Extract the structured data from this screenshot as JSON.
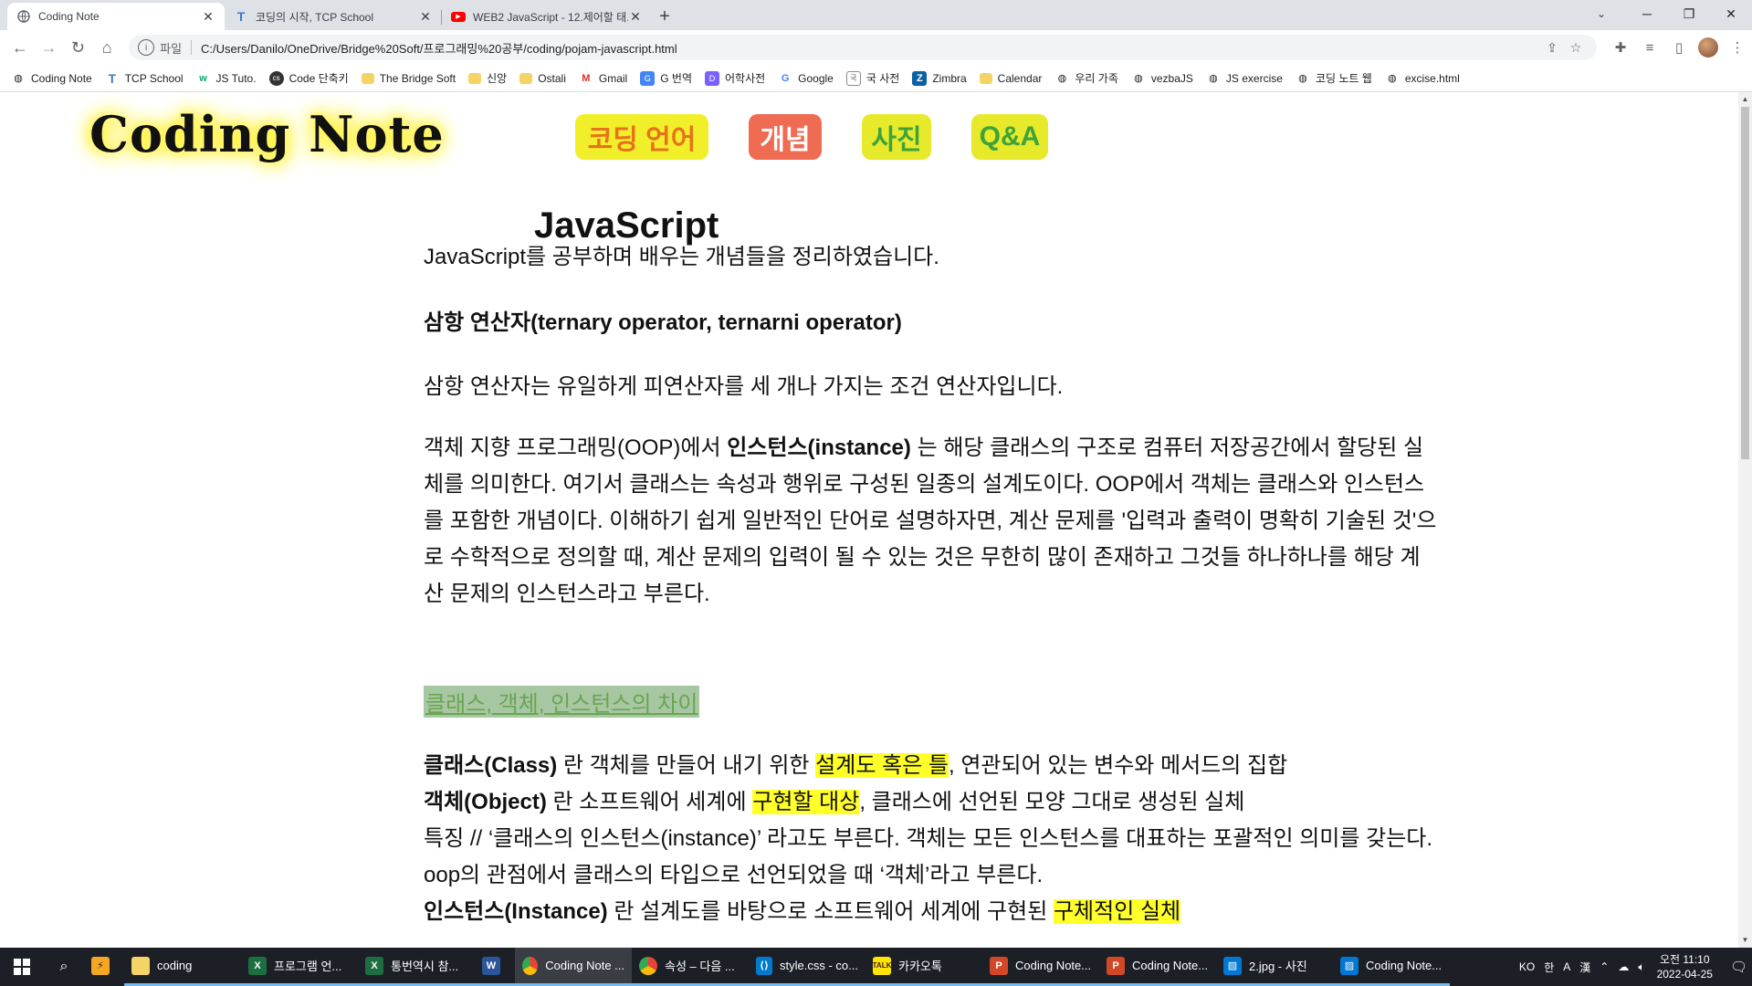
{
  "browser": {
    "tabs": [
      {
        "label": "Coding Note",
        "icon": "globe-icon",
        "active": true
      },
      {
        "label": "코딩의 시작, TCP School",
        "icon": "tcp-school-icon",
        "active": false
      },
      {
        "label": "WEB2 JavaScript - 12.제어할 태...",
        "icon": "youtube-icon",
        "active": false
      }
    ],
    "omnibox": {
      "scheme": "파일",
      "url": "C:/Users/Danilo/OneDrive/Bridge%20Soft/프로그래밍%20공부/coding/pojam-javascript.html"
    },
    "bookmarks": [
      {
        "label": "Coding Note",
        "icon": "globe-icon"
      },
      {
        "label": "TCP School",
        "icon": "tcp-school-icon"
      },
      {
        "label": "JS Tuto.",
        "icon": "w3-icon"
      },
      {
        "label": "Code 단축키",
        "icon": "code-icon"
      },
      {
        "label": "The Bridge Soft",
        "icon": "folder-icon"
      },
      {
        "label": "신앙",
        "icon": "folder-icon"
      },
      {
        "label": "Ostali",
        "icon": "folder-icon"
      },
      {
        "label": "Gmail",
        "icon": "gmail-icon"
      },
      {
        "label": "G 번역",
        "icon": "translate-icon"
      },
      {
        "label": "어학사전",
        "icon": "dictionary-icon"
      },
      {
        "label": "Google",
        "icon": "google-icon"
      },
      {
        "label": "국 사전",
        "icon": "dictionary-icon"
      },
      {
        "label": "Zimbra",
        "icon": "zimbra-icon"
      },
      {
        "label": "Calendar",
        "icon": "folder-icon"
      },
      {
        "label": "우리 가족",
        "icon": "globe-icon"
      },
      {
        "label": "vezbaJS",
        "icon": "globe-icon"
      },
      {
        "label": "JS exercise",
        "icon": "globe-icon"
      },
      {
        "label": "코딩 노트 웹",
        "icon": "globe-icon"
      },
      {
        "label": "excise.html",
        "icon": "globe-icon"
      }
    ]
  },
  "site": {
    "logo": "Coding Note",
    "nav": [
      "코딩 언어",
      "개념",
      "사진",
      "Q&A"
    ]
  },
  "article": {
    "title": "JavaScript",
    "intro": "JavaScript를 공부하며 배우는 개념들을 정리하였습니다.",
    "ternary_heading": "삼항 연산자(ternary operator, ternarni operator)",
    "ternary_text": "삼항 연산자는 유일하게 피연산자를 세 개나 가지는 조건 연산자입니다.",
    "instance_pre": "객체 지향 프로그래밍(OOP)에서 ",
    "instance_bold": "인스턴스(instance)",
    "instance_post": " 는 해당 클래스의 구조로 컴퓨터 저장공간에서 할당된 실체를 의미한다. 여기서 클래스는 속성과 행위로 구성된 일종의 설계도이다. OOP에서 객체는 클래스와 인스턴스를 포함한 개념이다. 이해하기 쉽게 일반적인 단어로 설명하자면, 계산 문제를 '입력과 출력이 명확히 기술된 것'으로 수학적으로 정의할 때, 계산 문제의 입력이 될 수 있는 것은 무한히 많이 존재하고 그것들 하나하나를 해당 계산 문제의 인스턴스라고 부른다.",
    "diff_link": "클래스, 객체, 인스턴스의 차이",
    "class_bold": "클래스(Class)",
    "class_pre": " 란 객체를 만들어 내기 위한 ",
    "class_hl": "설계도 혹은 틀",
    "class_post": ", 연관되어 있는 변수와 메서드의 집합",
    "object_bold": "객체(Object)",
    "object_pre": " 란 소프트웨어 세계에 ",
    "object_hl": "구현할 대상",
    "object_post": ", 클래스에 선언된 모양 그대로 생성된 실체",
    "feature_text": "특징 // ‘클래스의 인스턴스(instance)’ 라고도 부른다. 객체는 모든 인스턴스를 대표하는 포괄적인 의미를 갖는다.",
    "oop_text": "oop의 관점에서 클래스의 타입으로 선언되었을 때 ‘객체’라고 부른다.",
    "inst_bold": "인스턴스(Instance)",
    "inst_pre": " 란 설계도를 바탕으로 소프트웨어 세계에 구현된 ",
    "inst_hl": "구체적인 실체"
  },
  "taskbar": {
    "items": [
      {
        "label": "",
        "icon": "app-icon"
      },
      {
        "label": "coding",
        "icon": "folder-icon"
      },
      {
        "label": "프로그램 언...",
        "icon": "excel-icon"
      },
      {
        "label": "통번역시 참...",
        "icon": "excel-icon"
      },
      {
        "label": "",
        "icon": "word-icon"
      },
      {
        "label": "Coding Note ...",
        "icon": "chrome-icon"
      },
      {
        "label": "속성 – 다음 ...",
        "icon": "chrome-icon"
      },
      {
        "label": "style.css - co...",
        "icon": "vscode-icon"
      },
      {
        "label": "카카오톡",
        "icon": "kakaotalk-icon"
      },
      {
        "label": "Coding Note...",
        "icon": "powerpoint-icon"
      },
      {
        "label": "Coding Note...",
        "icon": "powerpoint-icon"
      },
      {
        "label": "2.jpg - 사진",
        "icon": "photos-icon"
      },
      {
        "label": "Coding Note...",
        "icon": "photos-icon"
      }
    ],
    "tray": {
      "lang": "KO",
      "ime1": "한",
      "ime2": "A",
      "ime3": "漢",
      "time": "오전 11:10",
      "date": "2022-04-25"
    }
  }
}
